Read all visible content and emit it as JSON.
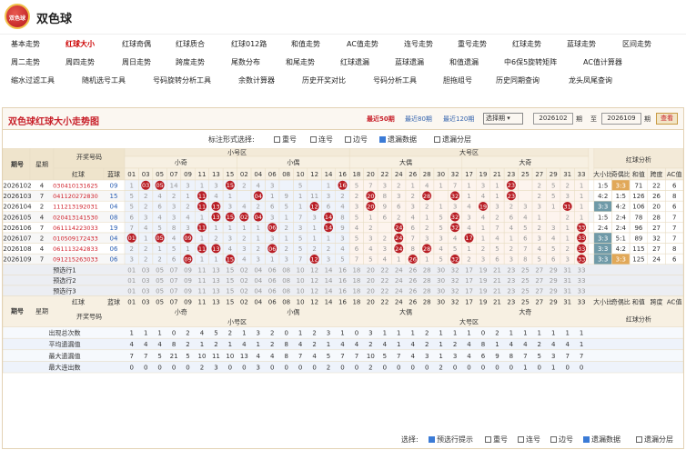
{
  "app": {
    "title": "双色球",
    "logo_text": "双色球"
  },
  "nav": {
    "rows": [
      [
        "基本走势",
        "红球大小",
        "红球奇偶",
        "红球质合",
        "红球012路",
        "和值走势",
        "AC值走势",
        "连号走势",
        "重号走势",
        "红球走势",
        "蓝球走势",
        "区间走势"
      ],
      [
        "周二走势",
        "周四走势",
        "周日走势",
        "跨度走势",
        "尾数分布",
        "和尾走势",
        "红球遗漏",
        "蓝球遗漏",
        "和值遗漏",
        "中6保5旋转矩阵",
        "AC值计算器"
      ],
      [
        "缩水过滤工具",
        "随机选号工具",
        "号码旋转分析工具",
        "余数计算器",
        "历史开奖对比",
        "号码分析工具",
        "胆拖组号",
        "历史同期查询",
        "龙头凤尾查询"
      ]
    ],
    "active": "红球大小"
  },
  "panel": {
    "title": "双色球红球大小走势图",
    "period_links": [
      "最近50期",
      "最近80期",
      "最近120期"
    ],
    "active_period": "最近50期",
    "select": "选择期",
    "start": "2026102",
    "end": "2026109",
    "qi": "期",
    "zhi": "至",
    "button": "查看"
  },
  "display_options": {
    "label": "标注形式选择:",
    "items": [
      {
        "label": "重号",
        "checked": false
      },
      {
        "label": "连号",
        "checked": false
      },
      {
        "label": "边号",
        "checked": false
      },
      {
        "label": "遗漏数据",
        "checked": true
      },
      {
        "label": "遗漏分层",
        "checked": false
      }
    ]
  },
  "headers": {
    "small_zone": "小号区",
    "big_zone": "大号区",
    "analysis": "红球分析",
    "issue": "期号",
    "week": "星期",
    "open": "开奖号码",
    "red": "红球",
    "blue": "蓝球",
    "small_odd": "小奇",
    "small_even": "小偶",
    "big_even": "大偶",
    "big_odd": "大奇",
    "ratio_bs": "大小比",
    "ratio_oe": "奇偶比",
    "sum": "和值",
    "span": "跨度",
    "ac": "AC值"
  },
  "columns": [
    1,
    3,
    5,
    7,
    9,
    11,
    13,
    15,
    2,
    4,
    6,
    8,
    10,
    12,
    14,
    16,
    18,
    20,
    22,
    24,
    26,
    28,
    30,
    32,
    17,
    19,
    21,
    23,
    25,
    27,
    29,
    31,
    33
  ],
  "draws": [
    {
      "issue": "2026102",
      "week": "4",
      "reds": [
        "03",
        "04",
        "10",
        "13",
        "16",
        "25"
      ],
      "blue": "09",
      "hit_cols": [
        1,
        2,
        7,
        15,
        27
      ],
      "miss": [
        "1",
        "2",
        "1",
        "14",
        "3",
        "1",
        "3",
        "5",
        "2",
        "4",
        "3",
        "",
        "5",
        "",
        "1",
        "1",
        "5",
        "7",
        "3",
        "2",
        "1",
        "4",
        "1",
        "7",
        "1",
        "3",
        "1",
        "1",
        "",
        "2",
        "5",
        "2",
        "1"
      ],
      "bs": "1:5",
      "oe": "3:3",
      "oe_hl": true,
      "sum": "71",
      "span": "22",
      "ac": "6"
    },
    {
      "issue": "2026103",
      "week": "7",
      "reds": [
        "04",
        "11",
        "20",
        "27",
        "28",
        "30"
      ],
      "blue": "15",
      "hit_cols": [
        9,
        5,
        17,
        27,
        21,
        23
      ],
      "miss": [
        "5",
        "2",
        "4",
        "2",
        "1",
        "",
        "4",
        "1",
        "",
        "5",
        "1",
        "9",
        "1",
        "11",
        "3",
        "2",
        "2",
        "",
        "8",
        "3",
        "2",
        "5",
        "",
        "7",
        "1",
        "4",
        "1",
        "1",
        "",
        "2",
        "5",
        "3",
        "1"
      ],
      "bs": "4:2",
      "oe": "1:5",
      "oe_hl": false,
      "sum": "126",
      "span": "26",
      "ac": "8"
    },
    {
      "issue": "2026104",
      "week": "2",
      "reds": [
        "11",
        "12",
        "13",
        "19",
        "20",
        "31"
      ],
      "blue": "04",
      "hit_cols": [
        5,
        6,
        13,
        17,
        25,
        31
      ],
      "miss": [
        "5",
        "2",
        "6",
        "3",
        "2",
        "",
        "",
        "3",
        "4",
        "2",
        "6",
        "5",
        "1",
        "",
        "6",
        "4",
        "3",
        "",
        "9",
        "6",
        "3",
        "2",
        "1",
        "3",
        "4",
        "",
        "3",
        "2",
        "3",
        "3",
        "1",
        "",
        "1"
      ],
      "bs": "3:3",
      "bs_hl": true,
      "oe": "4:2",
      "oe_hl": false,
      "sum": "106",
      "span": "20",
      "ac": "6"
    },
    {
      "issue": "2026105",
      "week": "4",
      "reds": [
        "02",
        "04",
        "13",
        "14",
        "15",
        "30"
      ],
      "blue": "08",
      "hit_cols": [
        6,
        7,
        8,
        9,
        14,
        23
      ],
      "miss": [
        "6",
        "3",
        "4",
        "3",
        "4",
        "1",
        "",
        "",
        "",
        "",
        "3",
        "1",
        "7",
        "3",
        "",
        "8",
        "5",
        "1",
        "6",
        "2",
        "4",
        "1",
        "5",
        "",
        "3",
        "4",
        "2",
        "6",
        "4",
        "1",
        "",
        "2",
        "1"
      ],
      "bs": "1:5",
      "oe": "2:4",
      "oe_hl": false,
      "sum": "78",
      "span": "28",
      "ac": "7"
    },
    {
      "issue": "2026106",
      "week": "7",
      "reds": [
        "06",
        "11",
        "14",
        "22",
        "30",
        "33"
      ],
      "blue": "19",
      "hit_cols": [
        5,
        10,
        14,
        19,
        23,
        32
      ],
      "miss": [
        "7",
        "4",
        "5",
        "8",
        "3",
        "",
        "1",
        "1",
        "1",
        "1",
        "",
        "2",
        "3",
        "1",
        "",
        "9",
        "4",
        "2",
        "",
        "3",
        "6",
        "2",
        "5",
        "",
        "4",
        "1",
        "7",
        "4",
        "5",
        "2",
        "3",
        "1",
        ""
      ],
      "bs": "2:4",
      "oe": "2:4",
      "oe_hl": false,
      "sum": "96",
      "span": "27",
      "ac": "7"
    },
    {
      "issue": "2026107",
      "week": "2",
      "reds": [
        "01",
        "05",
        "09",
        "17",
        "24",
        "33"
      ],
      "blue": "04",
      "hit_cols": [
        0,
        2,
        4,
        19,
        24,
        32
      ],
      "miss": [
        "",
        "1",
        "",
        "4",
        "",
        "1",
        "2",
        "3",
        "2",
        "1",
        "3",
        "1",
        "5",
        "1",
        "1",
        "3",
        "5",
        "3",
        "2",
        "",
        "7",
        "3",
        "3",
        "4",
        "",
        "1",
        "4",
        "1",
        "6",
        "3",
        "4",
        "1",
        ""
      ],
      "bs": "3:3",
      "bs_hl": true,
      "oe": "5:1",
      "oe_hl": false,
      "sum": "89",
      "span": "32",
      "ac": "7"
    },
    {
      "issue": "2026108",
      "week": "4",
      "reds": [
        "06",
        "11",
        "13",
        "24",
        "28",
        "33"
      ],
      "blue": "06",
      "hit_cols": [
        5,
        6,
        10,
        19,
        21,
        32
      ],
      "miss": [
        "2",
        "2",
        "1",
        "5",
        "1",
        "",
        "",
        "4",
        "3",
        "2",
        "",
        "2",
        "5",
        "2",
        "2",
        "4",
        "6",
        "4",
        "3",
        "",
        "8",
        "",
        "4",
        "5",
        "1",
        "2",
        "5",
        "2",
        "7",
        "4",
        "5",
        "2",
        ""
      ],
      "bs": "3:3",
      "bs_hl": true,
      "oe": "4:2",
      "oe_hl": false,
      "sum": "115",
      "span": "27",
      "ac": "8"
    },
    {
      "issue": "2026109",
      "week": "7",
      "reds": [
        "09",
        "12",
        "15",
        "26",
        "30",
        "33"
      ],
      "blue": "06",
      "hit_cols": [
        4,
        7,
        13,
        20,
        23,
        32
      ],
      "miss": [
        "3",
        "2",
        "2",
        "6",
        "",
        "1",
        "1",
        "",
        "4",
        "3",
        "1",
        "3",
        "7",
        "",
        "3",
        "5",
        "7",
        "5",
        "4",
        "1",
        "",
        "1",
        "5",
        "",
        "2",
        "3",
        "6",
        "3",
        "8",
        "5",
        "6",
        "3",
        ""
      ],
      "bs": "3:3",
      "bs_hl": true,
      "oe": "3:3",
      "oe_hl": true,
      "sum": "125",
      "span": "24",
      "ac": "6"
    }
  ],
  "predict_rows": [
    "预选行1",
    "预选行2",
    "预选行3"
  ],
  "stats": {
    "labels": [
      "出现总次数",
      "平均遗漏值",
      "最大遗漏值",
      "最大连出数"
    ],
    "rows": [
      [
        "1",
        "1",
        "1",
        "0",
        "2",
        "4",
        "5",
        "2",
        "1",
        "3",
        "2",
        "0",
        "1",
        "2",
        "3",
        "1",
        "0",
        "3",
        "1",
        "1",
        "1",
        "2",
        "1",
        "1",
        "1",
        "0",
        "2",
        "1",
        "1",
        "1",
        "1",
        "1",
        "1"
      ],
      [
        "4",
        "4",
        "4",
        "8",
        "2",
        "1",
        "2",
        "1",
        "4",
        "1",
        "2",
        "8",
        "4",
        "2",
        "1",
        "4",
        "4",
        "2",
        "4",
        "1",
        "4",
        "2",
        "1",
        "2",
        "4",
        "8",
        "1",
        "4",
        "4",
        "2",
        "4",
        "4",
        "1"
      ],
      [
        "7",
        "7",
        "5",
        "21",
        "5",
        "10",
        "11",
        "10",
        "13",
        "4",
        "4",
        "8",
        "7",
        "4",
        "5",
        "7",
        "7",
        "10",
        "5",
        "7",
        "4",
        "3",
        "1",
        "3",
        "4",
        "6",
        "9",
        "8",
        "7",
        "5",
        "3",
        "7",
        "7"
      ],
      [
        "0",
        "0",
        "0",
        "0",
        "0",
        "2",
        "3",
        "0",
        "0",
        "3",
        "0",
        "0",
        "0",
        "0",
        "2",
        "0",
        "0",
        "2",
        "0",
        "0",
        "0",
        "0",
        "2",
        "0",
        "0",
        "0",
        "0",
        "0",
        "1",
        "0",
        "1",
        "0",
        "0"
      ]
    ]
  },
  "footer": {
    "label": "选择:",
    "items": [
      {
        "label": "预选行提示",
        "checked": true
      },
      {
        "label": "重号",
        "checked": false
      },
      {
        "label": "连号",
        "checked": false
      },
      {
        "label": "边号",
        "checked": false
      },
      {
        "label": "遗漏数据",
        "checked": true
      },
      {
        "label": "遗漏分层",
        "checked": false
      }
    ]
  }
}
